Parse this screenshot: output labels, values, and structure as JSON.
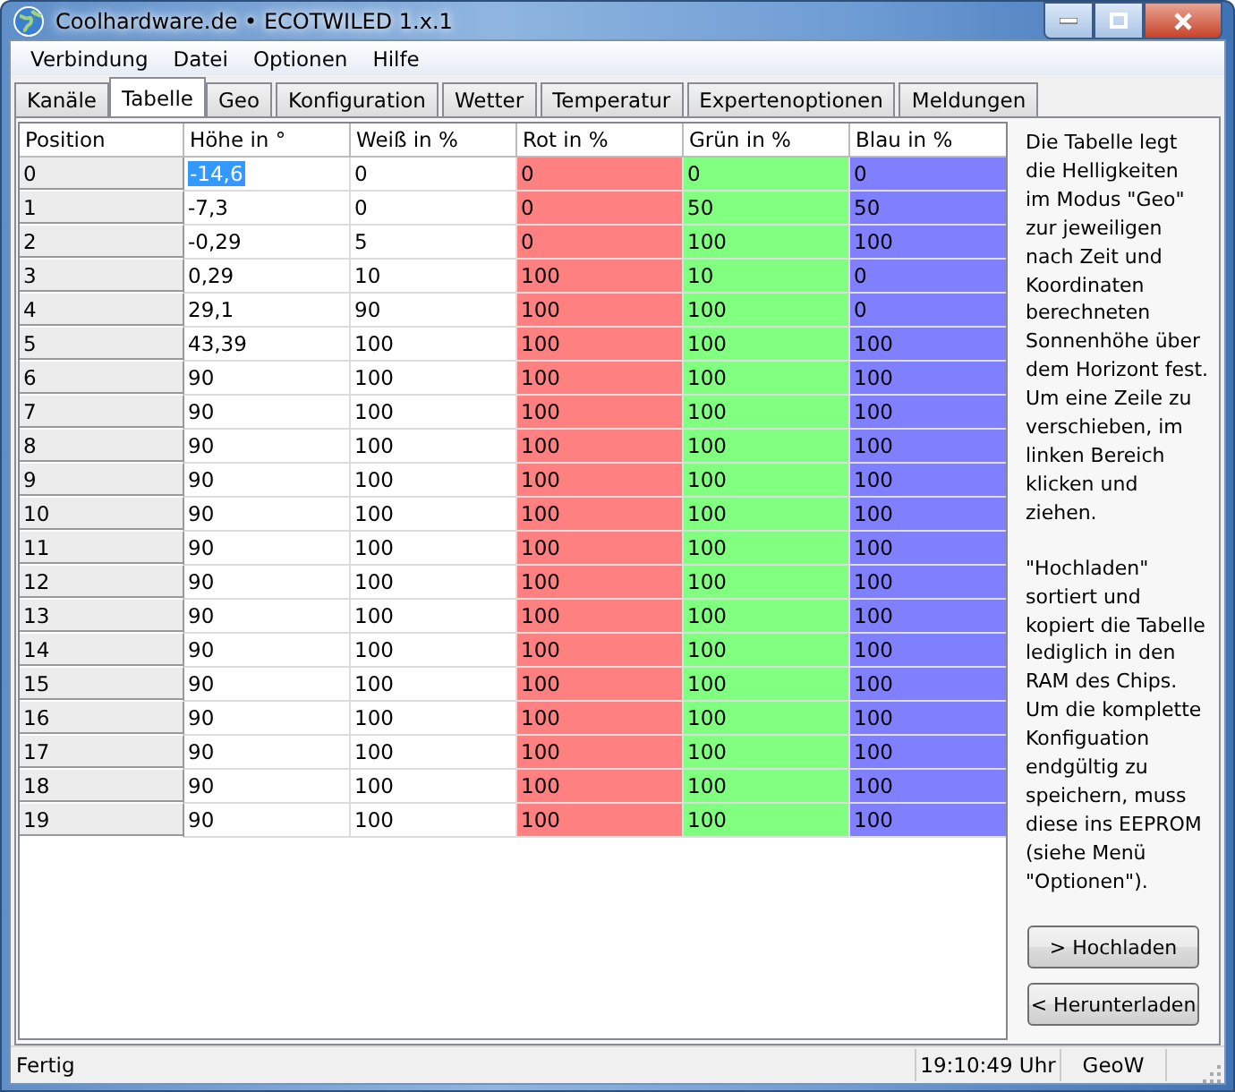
{
  "window": {
    "title": "Coolhardware.de • ECOTWILED 1.x.1"
  },
  "menu": [
    "Verbindung",
    "Datei",
    "Optionen",
    "Hilfe"
  ],
  "tabs": [
    {
      "label": "Kanäle",
      "selected": false
    },
    {
      "label": "Tabelle",
      "selected": true
    },
    {
      "label": "Geo",
      "selected": false
    },
    {
      "label": "Konfiguration",
      "selected": false
    },
    {
      "label": "Wetter",
      "selected": false
    },
    {
      "label": "Temperatur",
      "selected": false
    },
    {
      "label": "Expertenoptionen",
      "selected": false
    },
    {
      "label": "Meldungen",
      "selected": false
    }
  ],
  "table": {
    "columns": [
      {
        "label": "Position"
      },
      {
        "label": "Höhe in °"
      },
      {
        "label": "Weiß in %"
      },
      {
        "label": "Rot in %",
        "color": "#ff8080"
      },
      {
        "label": "Grün in %",
        "color": "#80ff80"
      },
      {
        "label": "Blau in %",
        "color": "#8080ff"
      }
    ],
    "rows": [
      {
        "cells": [
          "0",
          "-14,6",
          "0",
          "0",
          "0",
          "0"
        ],
        "selected": true
      },
      {
        "cells": [
          "1",
          "-7,3",
          "0",
          "0",
          "50",
          "50"
        ],
        "selected": false
      },
      {
        "cells": [
          "2",
          "-0,29",
          "5",
          "0",
          "100",
          "100"
        ],
        "selected": false
      },
      {
        "cells": [
          "3",
          "0,29",
          "10",
          "100",
          "10",
          "0"
        ],
        "selected": false
      },
      {
        "cells": [
          "4",
          "29,1",
          "90",
          "100",
          "100",
          "0"
        ],
        "selected": false
      },
      {
        "cells": [
          "5",
          "43,39",
          "100",
          "100",
          "100",
          "100"
        ],
        "selected": false
      },
      {
        "cells": [
          "6",
          "90",
          "100",
          "100",
          "100",
          "100"
        ],
        "selected": false
      },
      {
        "cells": [
          "7",
          "90",
          "100",
          "100",
          "100",
          "100"
        ],
        "selected": false
      },
      {
        "cells": [
          "8",
          "90",
          "100",
          "100",
          "100",
          "100"
        ],
        "selected": false
      },
      {
        "cells": [
          "9",
          "90",
          "100",
          "100",
          "100",
          "100"
        ],
        "selected": false
      },
      {
        "cells": [
          "10",
          "90",
          "100",
          "100",
          "100",
          "100"
        ],
        "selected": false
      },
      {
        "cells": [
          "11",
          "90",
          "100",
          "100",
          "100",
          "100"
        ],
        "selected": false
      },
      {
        "cells": [
          "12",
          "90",
          "100",
          "100",
          "100",
          "100"
        ],
        "selected": false
      },
      {
        "cells": [
          "13",
          "90",
          "100",
          "100",
          "100",
          "100"
        ],
        "selected": false
      },
      {
        "cells": [
          "14",
          "90",
          "100",
          "100",
          "100",
          "100"
        ],
        "selected": false
      },
      {
        "cells": [
          "15",
          "90",
          "100",
          "100",
          "100",
          "100"
        ],
        "selected": false
      },
      {
        "cells": [
          "16",
          "90",
          "100",
          "100",
          "100",
          "100"
        ],
        "selected": false
      },
      {
        "cells": [
          "17",
          "90",
          "100",
          "100",
          "100",
          "100"
        ],
        "selected": false
      },
      {
        "cells": [
          "18",
          "90",
          "100",
          "100",
          "100",
          "100"
        ],
        "selected": false
      },
      {
        "cells": [
          "19",
          "90",
          "100",
          "100",
          "100",
          "100"
        ],
        "selected": false
      }
    ]
  },
  "help": {
    "paragraphs": [
      "Die Tabelle legt die Helligkeiten im Modus \"Geo\" zur jeweiligen nach Zeit und Koordinaten berechneten Sonnenhöhe über dem Horizont fest.\nUm eine Zeile zu verschieben, im linken Bereich klicken und ziehen.",
      "\"Hochladen\" sortiert und kopiert die Tabelle lediglich in den RAM des Chips. Um die komplette Konfiguation endgültig zu speichern, muss diese ins EEPROM (siehe Menü \"Optionen\")."
    ],
    "buttons": [
      "> Hochladen",
      "< Herunterladen"
    ]
  },
  "status_bar": {
    "message": "Fertig",
    "time": "19:10:49 Uhr",
    "mode": "GeoW"
  }
}
